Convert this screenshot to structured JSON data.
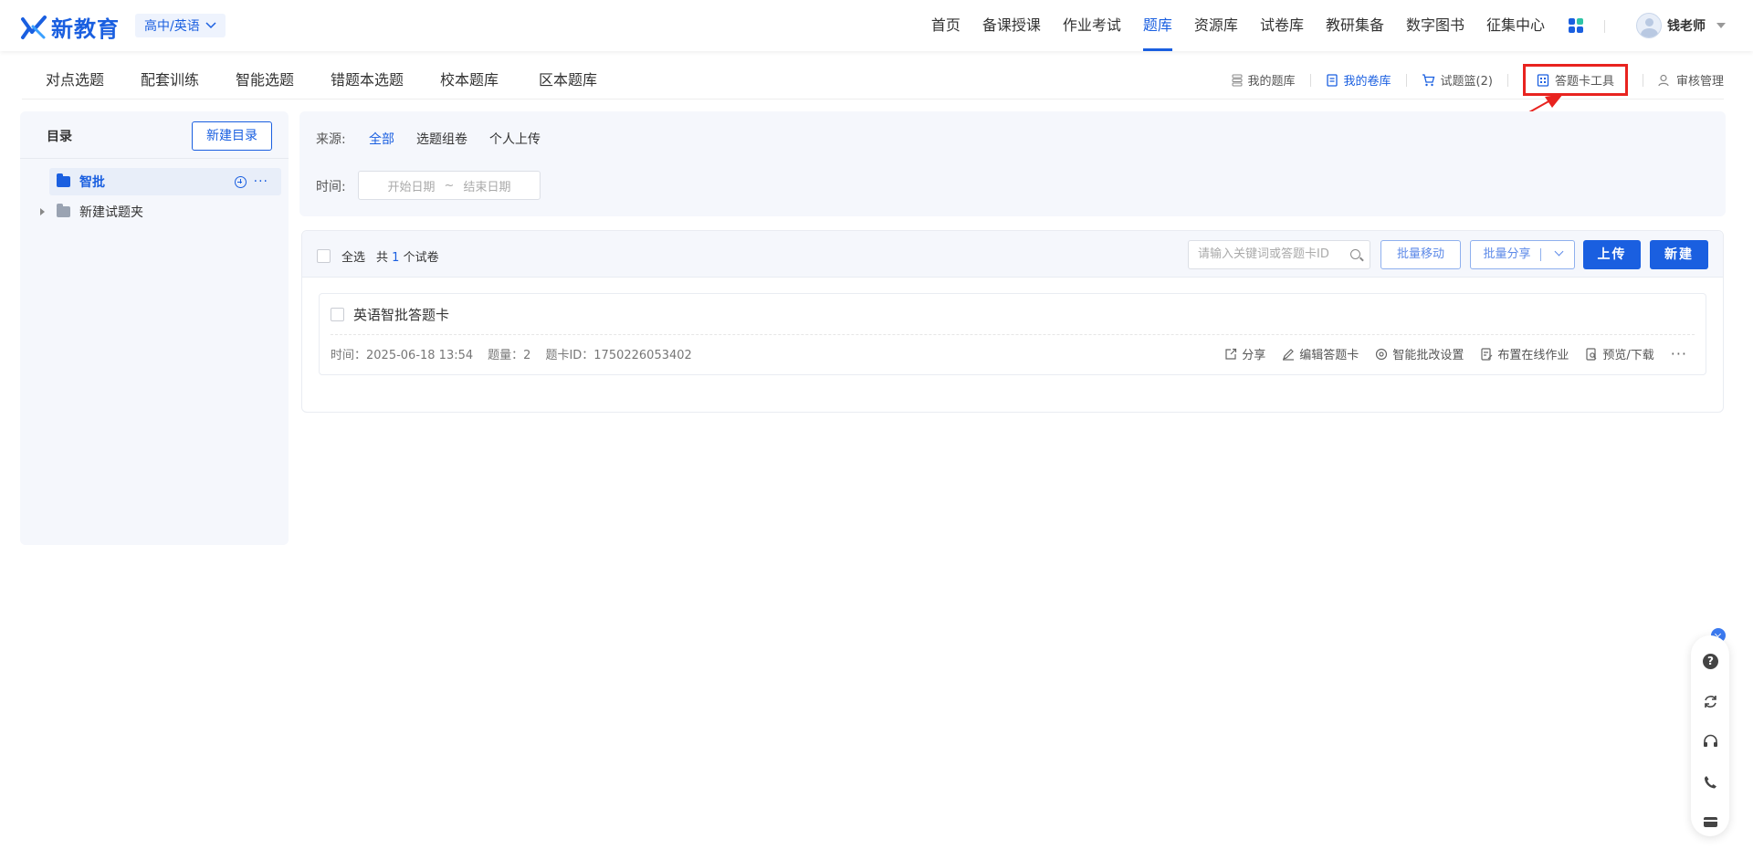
{
  "header": {
    "logo_text": "新教育",
    "grade_select": "高中/英语",
    "nav": [
      "首页",
      "备课授课",
      "作业考试",
      "题库",
      "资源库",
      "试卷库",
      "教研集备",
      "数字图书",
      "征集中心"
    ],
    "active_nav": "题库",
    "user_name": "钱老师"
  },
  "subnav": {
    "tabs": [
      "对点选题",
      "配套训练",
      "智能选题",
      "错题本选题",
      "校本题库",
      "区本题库"
    ],
    "tools": {
      "my_bank": "我的题库",
      "my_papers": "我的卷库",
      "basket": "试题篮(2)",
      "answer_card_tool": "答题卡工具",
      "review": "审核管理"
    }
  },
  "sidebar": {
    "title": "目录",
    "new_dir_button": "新建目录",
    "items": [
      {
        "label": "智批",
        "selected": true
      },
      {
        "label": "新建试题夹",
        "selected": false
      }
    ]
  },
  "filter": {
    "source_label": "来源:",
    "sources": [
      "全部",
      "选题组卷",
      "个人上传"
    ],
    "active_source": "全部",
    "time_label": "时间:",
    "start_placeholder": "开始日期",
    "range_sep": "~",
    "end_placeholder": "结束日期"
  },
  "list": {
    "select_all": "全选",
    "count_prefix": "共",
    "count": "1",
    "count_suffix": "个试卷",
    "search_placeholder": "请输入关键词或答题卡ID",
    "batch_move": "批量移动",
    "batch_share": "批量分享",
    "upload": "上传",
    "create": "新建",
    "items": [
      {
        "title": "英语智批答题卡",
        "time": "时间：2025-06-18 13:54",
        "count": "题量：2",
        "card_id": "题卡ID：1750226053402",
        "actions": [
          "分享",
          "编辑答题卡",
          "智能批改设置",
          "布置在线作业",
          "预览/下载"
        ]
      }
    ]
  },
  "colors": {
    "primary": "#1a5fe0",
    "highlight_red": "#e8231f",
    "panel_bg": "#f5f7fc"
  }
}
